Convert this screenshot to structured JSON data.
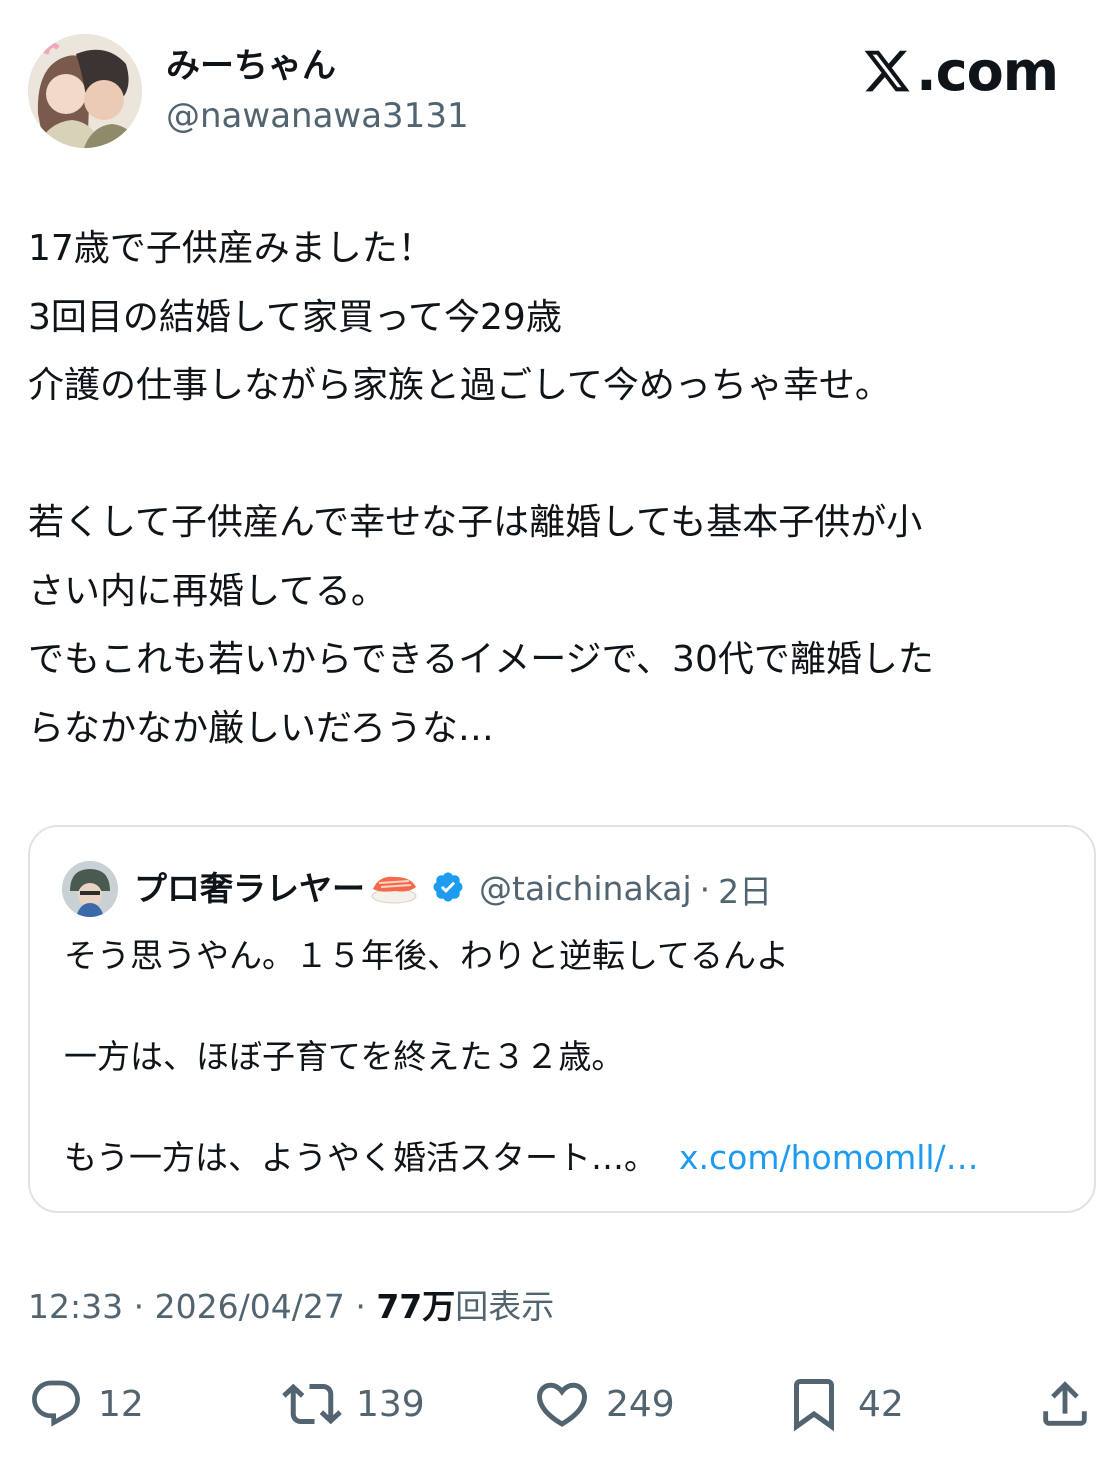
{
  "brand": {
    "logo_text": ".com"
  },
  "author": {
    "display_name": "みーちゃん",
    "handle": "@nawanawa3131"
  },
  "tweet": {
    "lines": [
      "17歳で子供産みました！",
      "3回目の結婚して家買って今29歳",
      "介護の仕事しながら家族と過ごして今めっちゃ幸せ。",
      "",
      "若くして子供産んで幸せな子は離婚しても基本子供が小",
      "さい内に再婚してる。",
      "でもこれも若いからできるイメージで、30代で離婚した",
      "らなかなか厳しいだろうな…"
    ]
  },
  "quote": {
    "display_name": "プロ奢ラレヤー",
    "handle": "@taichinakaj",
    "separator": "·",
    "time": "2日",
    "line1": "そう思うやん。１５年後、わりと逆転してるんよ",
    "line2": "一方は、ほぼ子育てを終えた３２歳。",
    "line3": "もう一方は、ようやく婚活スタート…。",
    "link": "x.com/homomll/…"
  },
  "meta": {
    "time": "12:33",
    "sep1": "·",
    "date": "2026/04/27",
    "sep2": "·",
    "views_count": "77万",
    "views_label": "回表示"
  },
  "actions": {
    "replies": "12",
    "reposts": "139",
    "likes": "249",
    "bookmarks": "42"
  },
  "colors": {
    "text": "#0f1419",
    "secondary": "#536471",
    "link": "#1d9bf0",
    "border": "#dfe3e8",
    "verified": "#1d9bf0"
  }
}
